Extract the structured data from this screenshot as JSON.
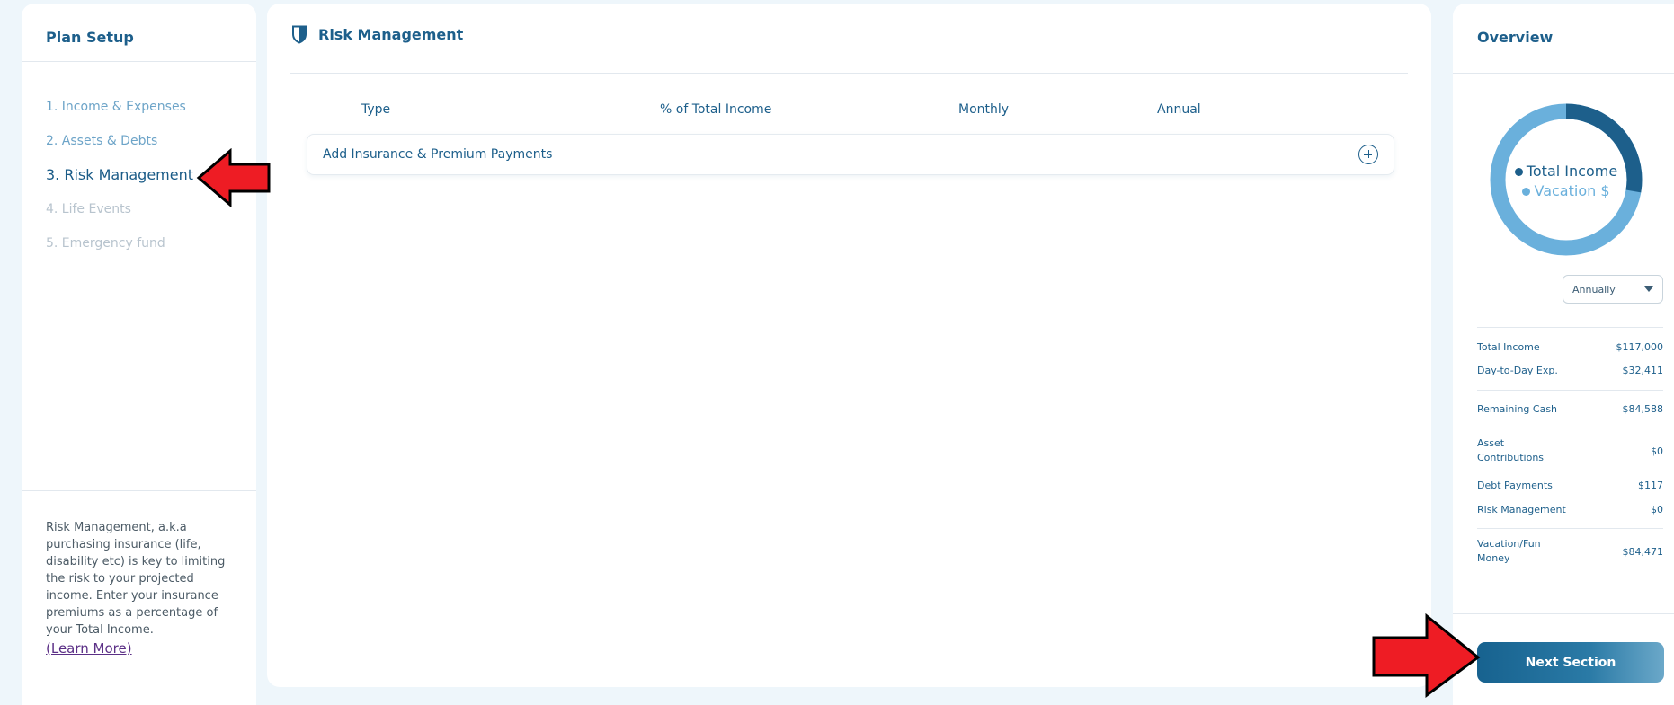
{
  "plan_setup": {
    "title": "Plan Setup",
    "steps": [
      {
        "label": "1. Income & Expenses",
        "state": "done"
      },
      {
        "label": "2. Assets & Debts",
        "state": "done"
      },
      {
        "label": "3. Risk Management",
        "state": "active"
      },
      {
        "label": "4. Life Events",
        "state": "pending"
      },
      {
        "label": "5. Emergency fund",
        "state": "pending"
      }
    ],
    "help_text": "Risk Management, a.k.a purchasing insurance (life, disability etc) is key to limiting the risk to your projected income. Enter your insurance premiums as a percentage of your Total Income.",
    "learn_more": "(Learn More)"
  },
  "main": {
    "title": "Risk Management",
    "icon": "shield-icon",
    "columns": [
      "Type",
      "% of Total Income",
      "Monthly",
      "Annual"
    ],
    "add_row_label": "Add Insurance & Premium Payments"
  },
  "overview": {
    "title": "Overview",
    "donut": {
      "legend": [
        {
          "name": "Total Income",
          "color": "#1d5f8b"
        },
        {
          "name": "Vacation $",
          "color": "#6ab0dc"
        }
      ],
      "values": [
        32411,
        84589
      ]
    },
    "period_select": "Annually",
    "summary": [
      {
        "label": "Total Income",
        "value": "$117,000"
      },
      {
        "label": "Day-to-Day Exp.",
        "value": "$32,411"
      },
      {
        "label": "Remaining Cash",
        "value": "$84,588"
      },
      {
        "label": "Asset Contributions",
        "value": "$0"
      },
      {
        "label": "Debt Payments",
        "value": "$117"
      },
      {
        "label": "Risk Management",
        "value": "$0"
      },
      {
        "label": "Vacation/Fun Money",
        "value": "$84,471"
      }
    ],
    "next_button": "Next Section"
  },
  "colors": {
    "primary": "#1d5f8b",
    "accent_light": "#6ab0dc",
    "annotation_arrow": "#ee1c24"
  }
}
